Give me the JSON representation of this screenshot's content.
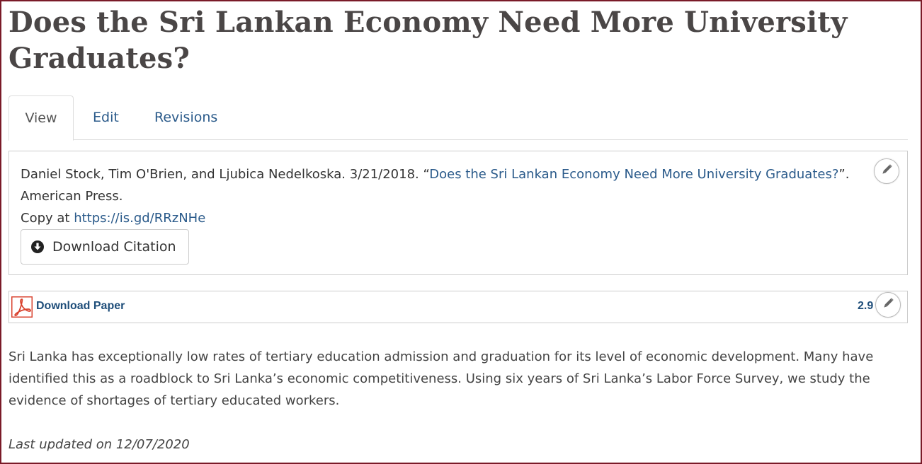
{
  "page": {
    "title": "Does the Sri Lankan Economy Need More University Graduates?"
  },
  "tabs": [
    {
      "label": "View",
      "active": true
    },
    {
      "label": "Edit",
      "active": false
    },
    {
      "label": "Revisions",
      "active": false
    }
  ],
  "citation": {
    "prefix": "Daniel Stock, Tim O'Brien, and Ljubica Nedelkoska. 3/21/2018. “",
    "link_text": "Does the Sri Lankan Economy Need More University Graduates?",
    "suffix": "”. American Press.",
    "copy_prefix": "Copy at ",
    "copy_link": "https://is.gd/RRzNHe",
    "download_label": "Download Citation"
  },
  "paper": {
    "download_label": "Download Paper",
    "file_size": "2.9",
    "icon": "pdf-icon"
  },
  "abstract": "Sri Lanka has exceptionally low rates of tertiary education admission and graduation for its level of economic development. Many have identified this as a roadblock to Sri Lanka’s economic competitiveness. Using six years of Sri Lanka’s Labor Force Survey, we study the evidence of shortages of tertiary educated workers.",
  "updated": "Last updated on 12/07/2020",
  "colors": {
    "frame_border": "#7a1a28",
    "link": "#2a5a8a",
    "pdf_red": "#d9432f"
  }
}
